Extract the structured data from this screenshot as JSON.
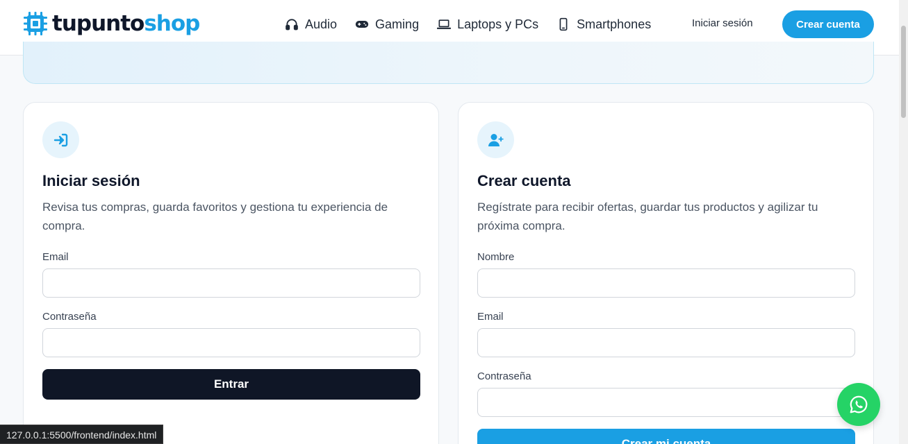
{
  "brand": {
    "name_part1": "tupunto",
    "name_part2": "shop",
    "accent": "#1a9fe3"
  },
  "nav": {
    "items": [
      {
        "label": "Audio",
        "icon": "headphones-icon"
      },
      {
        "label": "Gaming",
        "icon": "gamepad-icon"
      },
      {
        "label": "Laptops y PCs",
        "icon": "laptop-icon"
      },
      {
        "label": "Smartphones",
        "icon": "smartphone-icon"
      }
    ],
    "login_label": "Iniciar sesión",
    "signup_label": "Crear cuenta"
  },
  "login": {
    "icon": "sign-in-icon",
    "title": "Iniciar sesión",
    "description": "Revisa tus compras, guarda favoritos y gestiona tu experiencia de compra.",
    "email_label": "Email",
    "password_label": "Contraseña",
    "email_value": "",
    "password_value": "",
    "submit_label": "Entrar"
  },
  "register": {
    "icon": "user-plus-icon",
    "title": "Crear cuenta",
    "description": "Regístrate para recibir ofertas, guardar tus productos y agilizar tu próxima compra.",
    "name_label": "Nombre",
    "email_label": "Email",
    "password_label": "Contraseña",
    "name_value": "",
    "email_value": "",
    "password_value": "",
    "submit_label": "Crear mi cuenta"
  },
  "floating": {
    "icon": "whatsapp-icon",
    "color": "#25d366"
  },
  "statusbar": {
    "url": "127.0.0.1:5500/frontend/index.html"
  }
}
